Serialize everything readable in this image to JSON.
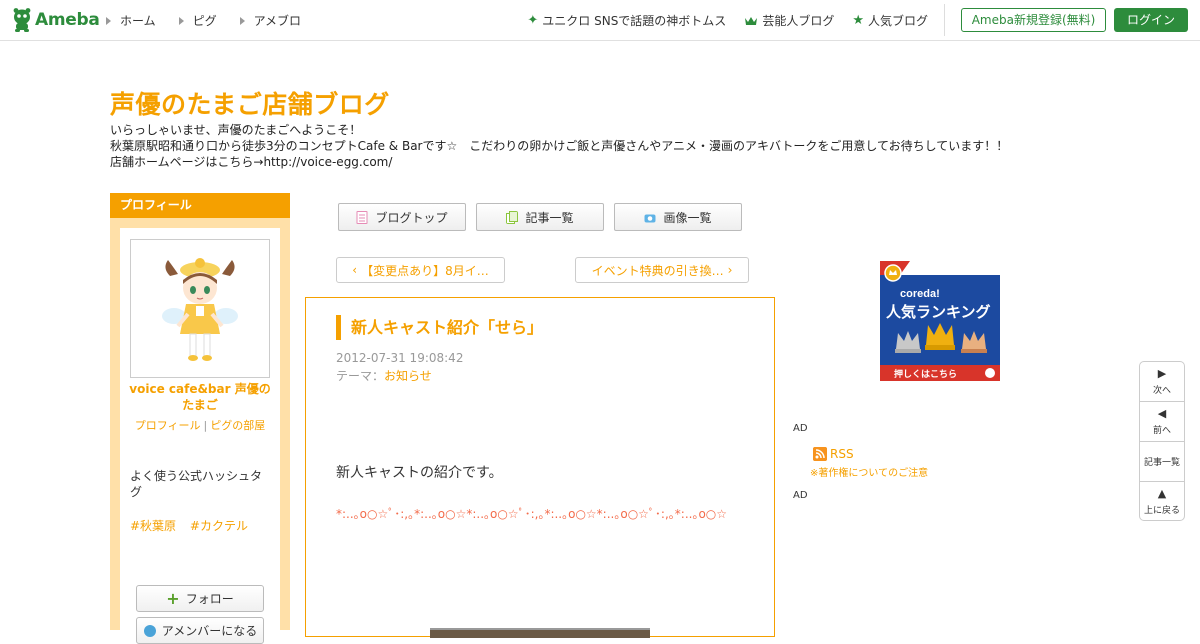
{
  "header": {
    "logo": "Ameba",
    "nav": [
      "ホーム",
      "ピグ",
      "アメブロ"
    ],
    "right_links": [
      {
        "icon": "sparkle-icon",
        "label": "ユニクロ SNSで話題の神ボトムス"
      },
      {
        "icon": "crown-icon",
        "label": "芸能人ブログ"
      },
      {
        "icon": "star-icon",
        "label": "人気ブログ"
      }
    ],
    "register": "Ameba新規登録(無料)",
    "login": "ログイン"
  },
  "blog": {
    "title": "声優のたまご店舗ブログ",
    "desc1": "いらっしゃいませ、声優のたまごへようこそ！",
    "desc2": "秋葉原駅昭和通り口から徒歩3分のコンセプトCafe & Barです☆　こだわりの卵かけご飯と声優さんやアニメ・漫画のアキバトークをご用意してお待ちしています！！",
    "desc3": "店舗ホームページはこちら→http://voice-egg.com/"
  },
  "sidebar": {
    "heading": "プロフィール",
    "name": "voice cafe&bar 声優のたまご",
    "profile_link": "プロフィール",
    "pig_link": "ピグの部屋",
    "hashtag_title": "よく使う公式ハッシュタグ",
    "hashtags": [
      "#秋葉原",
      "#カクテル"
    ],
    "follow": "フォロー",
    "member": "アメンバーになる"
  },
  "tabs": [
    {
      "label": "ブログトップ",
      "icon": "document-icon",
      "color": "#e68bb5"
    },
    {
      "label": "記事一覧",
      "icon": "list-icon",
      "color": "#8cc63e"
    },
    {
      "label": "画像一覧",
      "icon": "camera-icon",
      "color": "#5fb3e6"
    }
  ],
  "pager": {
    "prev": "【変更点あり】8月イ…",
    "next": "イベント特典の引き換…"
  },
  "article": {
    "title": "新人キャスト紹介「せら」",
    "date": "2012-07-31 19:08:42",
    "theme_label": "テーマ：",
    "theme": "お知らせ",
    "body": "新人キャストの紹介です。",
    "deco": "*:..｡o○☆ﾟ･:,｡*:..｡o○☆*:..｡o○☆ﾟ･:,｡*:..｡o○☆*:..｡o○☆ﾟ･:,｡*:..｡o○☆"
  },
  "right": {
    "banner_brand": "coreda!",
    "banner_title": "人気ランキング",
    "banner_cta": "押しくはこちら",
    "ad1": "AD",
    "rss": "RSS",
    "copyright": "※著作権についてのご注意",
    "ad2": "AD"
  },
  "sidenav": [
    {
      "symbol": "▶",
      "label": "次へ"
    },
    {
      "symbol": "◀",
      "label": "前へ"
    },
    {
      "symbol": "",
      "label": "記事一覧"
    },
    {
      "symbol": "▲",
      "label": "上に戻る"
    }
  ],
  "colors": {
    "brand": "#2d8c3c",
    "accent": "#f5a000",
    "sidebar_bg": "#ffe0a8",
    "deco": "#f36b4a"
  }
}
